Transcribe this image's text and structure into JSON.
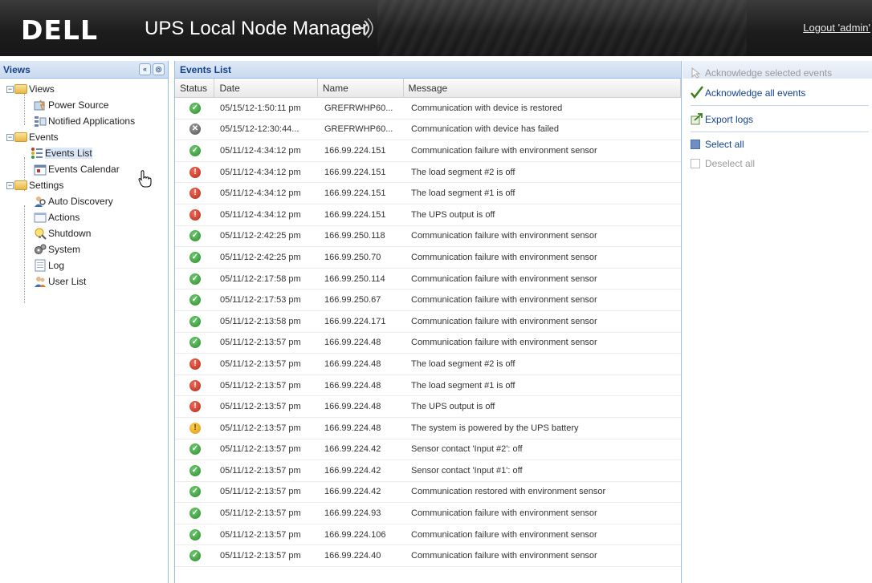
{
  "header": {
    "logo": "DELL",
    "app_title": "UPS Local Node Manager",
    "logout": "Logout 'admin'"
  },
  "left_panel": {
    "title": "Views",
    "tree": {
      "views": {
        "label": "Views",
        "children": [
          "Power Source",
          "Notified Applications"
        ]
      },
      "events": {
        "label": "Events",
        "children": [
          "Events List",
          "Events Calendar"
        ]
      },
      "settings": {
        "label": "Settings",
        "children": [
          "Auto Discovery",
          "Actions",
          "Shutdown",
          "System",
          "Log",
          "User List"
        ]
      }
    },
    "selected": "Events List"
  },
  "grid": {
    "title": "Events List",
    "columns": [
      "Status",
      "Date",
      "Name",
      "Message"
    ],
    "rows": [
      {
        "status": "ok",
        "date": "05/15/12-1:50:11 pm",
        "name": "GREFRWHP60...",
        "message": "Communication with device is restored"
      },
      {
        "status": "off",
        "date": "05/15/12-12:30:44...",
        "name": "GREFRWHP60...",
        "message": "Communication with device has failed"
      },
      {
        "status": "ok",
        "date": "05/11/12-4:34:12 pm",
        "name": "166.99.224.151",
        "message": "Communication failure with environment sensor"
      },
      {
        "status": "err",
        "date": "05/11/12-4:34:12 pm",
        "name": "166.99.224.151",
        "message": "The load segment #2 is off"
      },
      {
        "status": "err",
        "date": "05/11/12-4:34:12 pm",
        "name": "166.99.224.151",
        "message": "The load segment #1 is off"
      },
      {
        "status": "err",
        "date": "05/11/12-4:34:12 pm",
        "name": "166.99.224.151",
        "message": "The UPS output is off"
      },
      {
        "status": "ok",
        "date": "05/11/12-2:42:25 pm",
        "name": "166.99.250.118",
        "message": "Communication failure with environment sensor"
      },
      {
        "status": "ok",
        "date": "05/11/12-2:42:25 pm",
        "name": "166.99.250.70",
        "message": "Communication failure with environment sensor"
      },
      {
        "status": "ok",
        "date": "05/11/12-2:17:58 pm",
        "name": "166.99.250.114",
        "message": "Communication failure with environment sensor"
      },
      {
        "status": "ok",
        "date": "05/11/12-2:17:53 pm",
        "name": "166.99.250.67",
        "message": "Communication failure with environment sensor"
      },
      {
        "status": "ok",
        "date": "05/11/12-2:13:58 pm",
        "name": "166.99.224.171",
        "message": "Communication failure with environment sensor"
      },
      {
        "status": "ok",
        "date": "05/11/12-2:13:57 pm",
        "name": "166.99.224.48",
        "message": "Communication failure with environment sensor"
      },
      {
        "status": "err",
        "date": "05/11/12-2:13:57 pm",
        "name": "166.99.224.48",
        "message": "The load segment #2 is off"
      },
      {
        "status": "err",
        "date": "05/11/12-2:13:57 pm",
        "name": "166.99.224.48",
        "message": "The load segment #1 is off"
      },
      {
        "status": "err",
        "date": "05/11/12-2:13:57 pm",
        "name": "166.99.224.48",
        "message": "The UPS output is off"
      },
      {
        "status": "warn",
        "date": "05/11/12-2:13:57 pm",
        "name": "166.99.224.48",
        "message": "The system is powered by the UPS battery"
      },
      {
        "status": "ok",
        "date": "05/11/12-2:13:57 pm",
        "name": "166.99.224.42",
        "message": "Sensor contact 'Input #2': off"
      },
      {
        "status": "ok",
        "date": "05/11/12-2:13:57 pm",
        "name": "166.99.224.42",
        "message": "Sensor contact 'Input #1': off"
      },
      {
        "status": "ok",
        "date": "05/11/12-2:13:57 pm",
        "name": "166.99.224.42",
        "message": "Communication restored with environment sensor"
      },
      {
        "status": "ok",
        "date": "05/11/12-2:13:57 pm",
        "name": "166.99.224.93",
        "message": "Communication failure with environment sensor"
      },
      {
        "status": "ok",
        "date": "05/11/12-2:13:57 pm",
        "name": "166.99.224.106",
        "message": "Communication failure with environment sensor"
      },
      {
        "status": "ok",
        "date": "05/11/12-2:13:57 pm",
        "name": "166.99.224.40",
        "message": "Communication failure with environment sensor"
      }
    ]
  },
  "actions": {
    "ack_selected": "Acknowledge selected events",
    "ack_all": "Acknowledge all events",
    "export_logs": "Export logs",
    "select_all": "Select all",
    "deselect_all": "Deselect all"
  },
  "colors": {
    "header_bg": "#1d1d1d",
    "panel_header_text": "#15428b",
    "link_blue": "#15428b",
    "disabled_text": "#9a9a9a"
  },
  "icons": {
    "ok": "check-icon",
    "err": "exclamation-icon",
    "warn": "warning-icon",
    "off": "x-icon"
  }
}
